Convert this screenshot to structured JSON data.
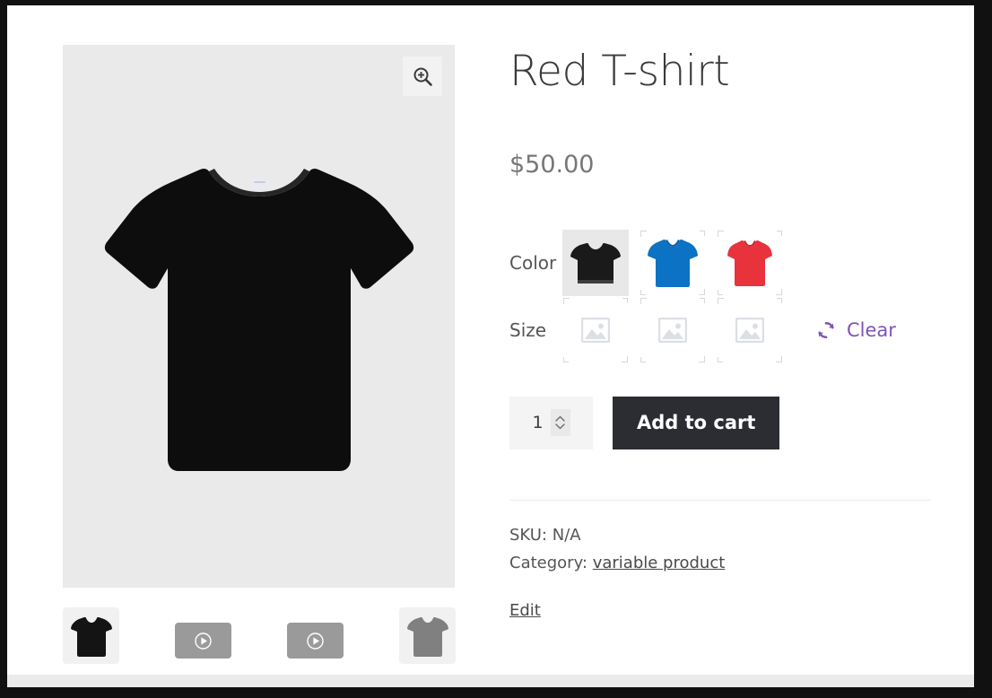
{
  "product": {
    "title": "Red T-shirt",
    "price": "$50.00",
    "main_image_alt": "black-tshirt-main-image"
  },
  "gallery": {
    "zoom_icon": "magnifier-plus-icon",
    "thumbnails": [
      {
        "name": "thumbnail-black-tshirt",
        "type": "image",
        "color": "#141414"
      },
      {
        "name": "thumbnail-video-1",
        "type": "video",
        "icon": "play-circle-icon"
      },
      {
        "name": "thumbnail-video-2",
        "type": "video",
        "icon": "play-circle-icon"
      },
      {
        "name": "thumbnail-gray-tshirt",
        "type": "image",
        "color": "#808080"
      }
    ]
  },
  "variations": {
    "rows": [
      {
        "label": "Color",
        "options": [
          {
            "name": "swatch-color-black",
            "value": "Black",
            "color": "#1a1a1a",
            "selected": true
          },
          {
            "name": "swatch-color-blue",
            "value": "Blue",
            "color": "#0b72c4",
            "selected": false
          },
          {
            "name": "swatch-color-red",
            "value": "Red",
            "color": "#e8323c",
            "selected": false
          }
        ]
      },
      {
        "label": "Size",
        "options": [
          {
            "name": "swatch-size-1",
            "value": "",
            "placeholder": true,
            "selected": false
          },
          {
            "name": "swatch-size-2",
            "value": "",
            "placeholder": true,
            "selected": false
          },
          {
            "name": "swatch-size-3",
            "value": "",
            "placeholder": true,
            "selected": false
          }
        ]
      }
    ],
    "clear_label": "Clear",
    "clear_icon": "refresh-circle-arrows-icon"
  },
  "cart": {
    "quantity": "1",
    "quantity_placeholder": "1",
    "spinner_up_icon": "chevron-up-icon",
    "spinner_down_icon": "chevron-down-icon",
    "add_to_cart_label": "Add to cart"
  },
  "meta": {
    "sku_label": "SKU:",
    "sku_value": "N/A",
    "category_label": "Category:",
    "category_value": "variable product",
    "edit_label": "Edit"
  },
  "colors": {
    "accent_purple": "#7f54b3",
    "button_dark": "#2c2d33",
    "image_bg": "#eaeaea",
    "title_gray": "#3a3a3a",
    "price_gray": "#777777"
  }
}
